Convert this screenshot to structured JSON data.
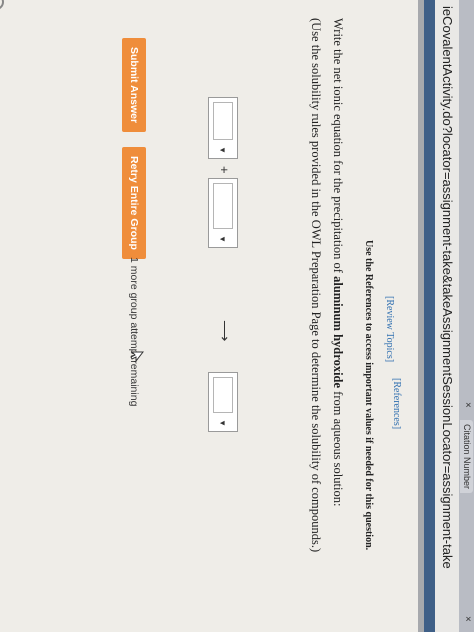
{
  "browser": {
    "tab_title": "Citation Number",
    "tab_close_glyph": "×",
    "url": "ieCovalentActivity.do?locator=assignment-take&takeAssignmentSessionLocator=assignment-take"
  },
  "question": {
    "references_link": "[References]",
    "review_topics_link": "[Review Topics]",
    "references_note": "Use the References to access important values if needed for this question.",
    "prompt_prefix": "Write the net ionic equation for the precipitation of ",
    "prompt_bold": "aluminum hydroxide",
    "prompt_suffix": " from aqueous solution:",
    "solubility_note": "(Use the solubility rules provided in the OWL Preparation Page to determine the solubility of compounds.)",
    "plus_sign": "+",
    "yields_arrow": "⟶",
    "dropdown_arrow": "▼"
  },
  "actions": {
    "submit_label": "Submit Answer",
    "retry_label": "Retry Entire Group",
    "attempts_text": "1 more group attempt remaining"
  }
}
